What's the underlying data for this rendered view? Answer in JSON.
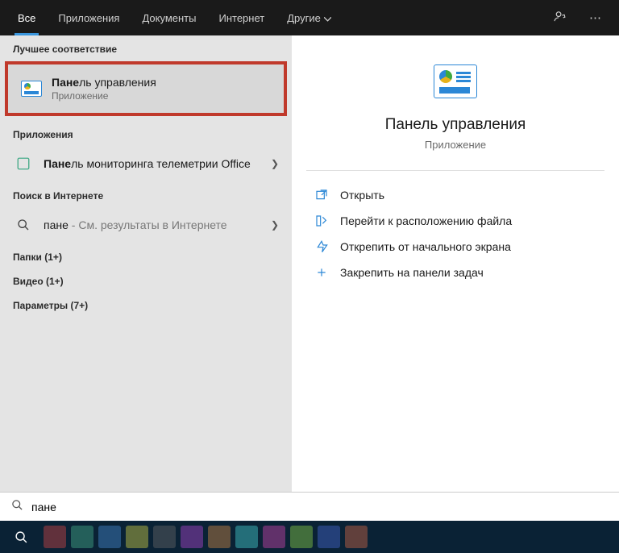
{
  "tabs": {
    "all": "Все",
    "apps": "Приложения",
    "docs": "Документы",
    "web": "Интернет",
    "more": "Другие"
  },
  "left": {
    "best_match_hdr": "Лучшее соответствие",
    "best": {
      "title_match": "Пане",
      "title_rest": "ль управления",
      "sub": "Приложение"
    },
    "apps_hdr": "Приложения",
    "app1": {
      "title_match": "Пане",
      "title_rest": "ль мониторинга телеметрии Office"
    },
    "web_hdr": "Поиск в Интернете",
    "web1": {
      "query": "пане",
      "suffix": " - См. результаты в Интернете"
    },
    "folders_hdr": "Папки (1+)",
    "videos_hdr": "Видео (1+)",
    "settings_hdr": "Параметры (7+)"
  },
  "right": {
    "title": "Панель управления",
    "sub": "Приложение",
    "actions": {
      "open": "Открыть",
      "goto": "Перейти к расположению файла",
      "unpin_start": "Открепить от начального экрана",
      "pin_taskbar": "Закрепить на панели задач"
    }
  },
  "search": {
    "value": "пане"
  }
}
